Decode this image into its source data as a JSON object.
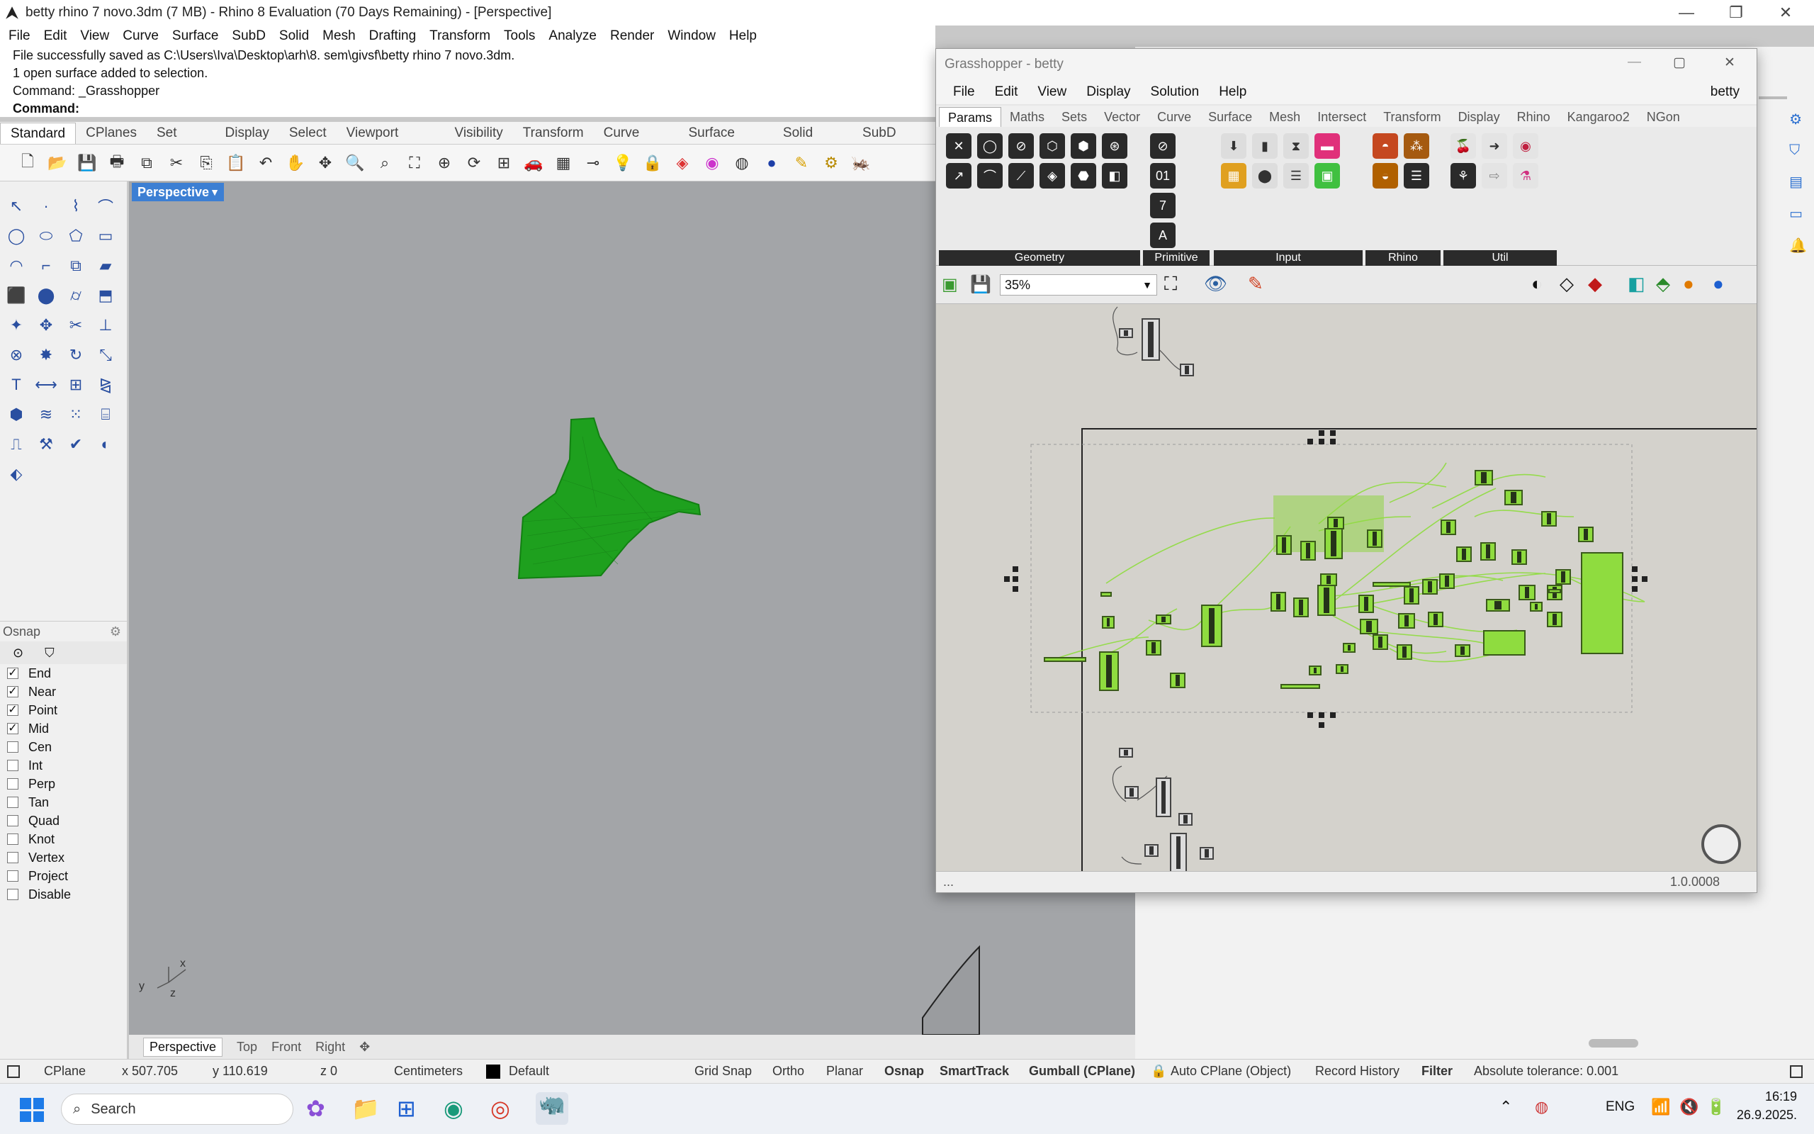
{
  "window": {
    "title": "betty rhino 7 novo.3dm (7 MB) - Rhino 8 Evaluation (70 Days Remaining) - [Perspective]",
    "minimize": "—",
    "maximize": "❐",
    "close": "✕"
  },
  "menu": [
    "File",
    "Edit",
    "View",
    "Curve",
    "Surface",
    "SubD",
    "Solid",
    "Mesh",
    "Drafting",
    "Transform",
    "Tools",
    "Analyze",
    "Render",
    "Window",
    "Help"
  ],
  "command_history": [
    "File successfully saved as C:\\Users\\Iva\\Desktop\\arh\\8. sem\\givsf\\betty rhino 7 novo.3dm.",
    "1 open surface added to selection.",
    "Command: _Grasshopper"
  ],
  "command_prompt": "Command:",
  "toolbar_tabs": [
    "Standard",
    "CPlanes",
    "Set View",
    "Display",
    "Select",
    "Viewport Layout",
    "Visibility",
    "Transform",
    "Curve Tools",
    "Surface Tools",
    "Solid Tools",
    "SubD Tools"
  ],
  "toolbar_icons": [
    "new-icon",
    "open-icon",
    "save-icon",
    "print-icon",
    "import-icon",
    "cut-icon",
    "copy-icon",
    "paste-icon",
    "undo-icon",
    "pan-icon",
    "rotate-view-icon",
    "zoom-icon",
    "zoom-window-icon",
    "zoom-extents-icon",
    "zoom-selected-icon",
    "rotate-icon",
    "four-viewports-icon",
    "car-icon",
    "grid-icon",
    "curve-icon",
    "light-icon",
    "lock-icon",
    "layer-icon",
    "color-wheel-icon",
    "sphere-wire-icon",
    "render-sphere-icon",
    "pen-icon",
    "settings-gear-icon",
    "grasshopper-icon"
  ],
  "viewport": {
    "name": "Perspective",
    "tabs": [
      "Perspective",
      "Top",
      "Front",
      "Right"
    ],
    "mesh_color": "#1ea01e",
    "axis_x": "x",
    "axis_y": "y",
    "axis_z": "z"
  },
  "osnap": {
    "title": "Osnap",
    "items": [
      {
        "label": "End",
        "checked": true
      },
      {
        "label": "Near",
        "checked": true
      },
      {
        "label": "Point",
        "checked": true
      },
      {
        "label": "Mid",
        "checked": true
      },
      {
        "label": "Cen",
        "checked": false
      },
      {
        "label": "Int",
        "checked": false
      },
      {
        "label": "Perp",
        "checked": false
      },
      {
        "label": "Tan",
        "checked": false
      },
      {
        "label": "Quad",
        "checked": false
      },
      {
        "label": "Knot",
        "checked": false
      },
      {
        "label": "Vertex",
        "checked": false
      },
      {
        "label": "Project",
        "checked": false
      },
      {
        "label": "Disable",
        "checked": false
      }
    ]
  },
  "status": {
    "cplane": "CPlane",
    "x": "x 507.705",
    "y": "y 110.619",
    "z": "z 0",
    "units": "Centimeters",
    "layer": "Default",
    "grid_snap": "Grid Snap",
    "ortho": "Ortho",
    "planar": "Planar",
    "osnap": "Osnap",
    "smarttrack": "SmartTrack",
    "gumball": "Gumball (CPlane)",
    "auto_cplane": "Auto CPlane (Object)",
    "record_history": "Record History",
    "filter": "Filter",
    "tolerance": "Absolute tolerance: 0.001"
  },
  "grasshopper": {
    "title": "Grasshopper - betty",
    "doc_name": "betty",
    "menu": [
      "File",
      "Edit",
      "View",
      "Display",
      "Solution",
      "Help"
    ],
    "tabs": [
      "Params",
      "Maths",
      "Sets",
      "Vector",
      "Curve",
      "Surface",
      "Mesh",
      "Intersect",
      "Transform",
      "Display",
      "Rhino",
      "Kangaroo2",
      "NGon"
    ],
    "groups": [
      "Geometry",
      "Primitive",
      "Input",
      "Rhino",
      "Util"
    ],
    "zoom": "35%",
    "footer_left": "...",
    "version": "1.0.0008",
    "accent": "#8fdc3f"
  },
  "taskbar": {
    "search": "Search",
    "lang": "ENG",
    "time": "16:19",
    "date": "26.9.2025."
  }
}
